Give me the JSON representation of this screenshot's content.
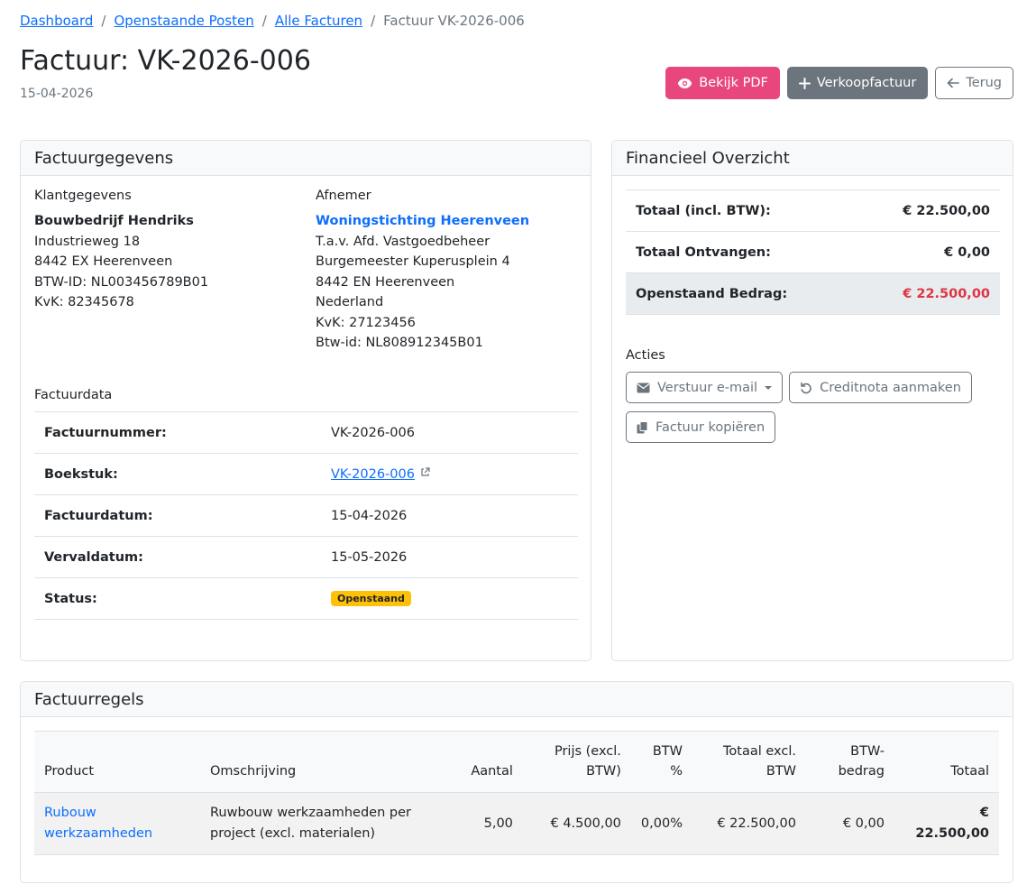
{
  "breadcrumb": {
    "items": [
      "Dashboard",
      "Openstaande Posten",
      "Alle Facturen"
    ],
    "current": "Factuur VK-2026-006",
    "separator": "/"
  },
  "header": {
    "title": "Factuur: VK-2026-006",
    "date": "15-04-2026",
    "buttons": {
      "view_pdf": "Bekijk PDF",
      "new_sales_invoice": "Verkoopfactuur",
      "back": "Terug"
    }
  },
  "details": {
    "title": "Factuurgegevens",
    "customer": {
      "heading": "Klantgegevens",
      "name": "Bouwbedrijf Hendriks",
      "lines": [
        "Industrieweg 18",
        "8442 EX Heerenveen",
        "BTW-ID: NL003456789B01",
        "KvK: 82345678"
      ]
    },
    "recipient": {
      "heading": "Afnemer",
      "name": "Woningstichting Heerenveen",
      "lines": [
        "T.a.v. Afd. Vastgoedbeheer",
        "Burgemeester Kuperusplein 4",
        "8442 EN Heerenveen",
        "Nederland",
        "KvK: 27123456",
        "Btw-id: NL808912345B01"
      ]
    },
    "invoice_data": {
      "heading": "Factuurdata",
      "rows": [
        {
          "label": "Factuurnummer:",
          "value": "VK-2026-006"
        },
        {
          "label": "Boekstuk:",
          "value": "VK-2026-006"
        },
        {
          "label": "Factuurdatum:",
          "value": "15-04-2026"
        },
        {
          "label": "Vervaldatum:",
          "value": "15-05-2026"
        },
        {
          "label": "Status:",
          "value": "Openstaand"
        }
      ]
    }
  },
  "finance": {
    "title": "Financieel Overzicht",
    "rows": [
      {
        "label": "Totaal (incl. BTW):",
        "value": "€ 22.500,00"
      },
      {
        "label": "Totaal Ontvangen:",
        "value": "€ 0,00"
      },
      {
        "label": "Openstaand Bedrag:",
        "value": "€ 22.500,00"
      }
    ],
    "actions_label": "Acties",
    "actions": {
      "send_email": "Verstuur e-mail",
      "credit_note": "Creditnota aanmaken",
      "copy_invoice": "Factuur kopiëren"
    }
  },
  "lines": {
    "title": "Factuurregels",
    "headers": {
      "product": "Product",
      "description": "Omschrijving",
      "qty": "Aantal",
      "price_1": "Prijs (excl.",
      "price_2": "BTW)",
      "vat_1": "BTW",
      "vat_2": "%",
      "total_excl_1": "Totaal excl.",
      "total_excl_2": "BTW",
      "vat_amount_1": "BTW-",
      "vat_amount_2": "bedrag",
      "total": "Totaal"
    },
    "rows": [
      {
        "product_1": "Rubouw",
        "product_2": "werkzaamheden",
        "description_1": "Ruwbouw werkzaamheden per",
        "description_2": "project (excl. materialen)",
        "qty": "5,00",
        "price": "€ 4.500,00",
        "vat": "0,00%",
        "total_excl": "€ 22.500,00",
        "vat_amount": "€ 0,00",
        "total": "€ 22.500,00"
      }
    ]
  },
  "colors": {
    "link": "#0d6efd",
    "pdf_button": "#e8477e",
    "secondary": "#6c757d",
    "status_badge": "#ffc107",
    "outstanding": "#dc3545"
  }
}
